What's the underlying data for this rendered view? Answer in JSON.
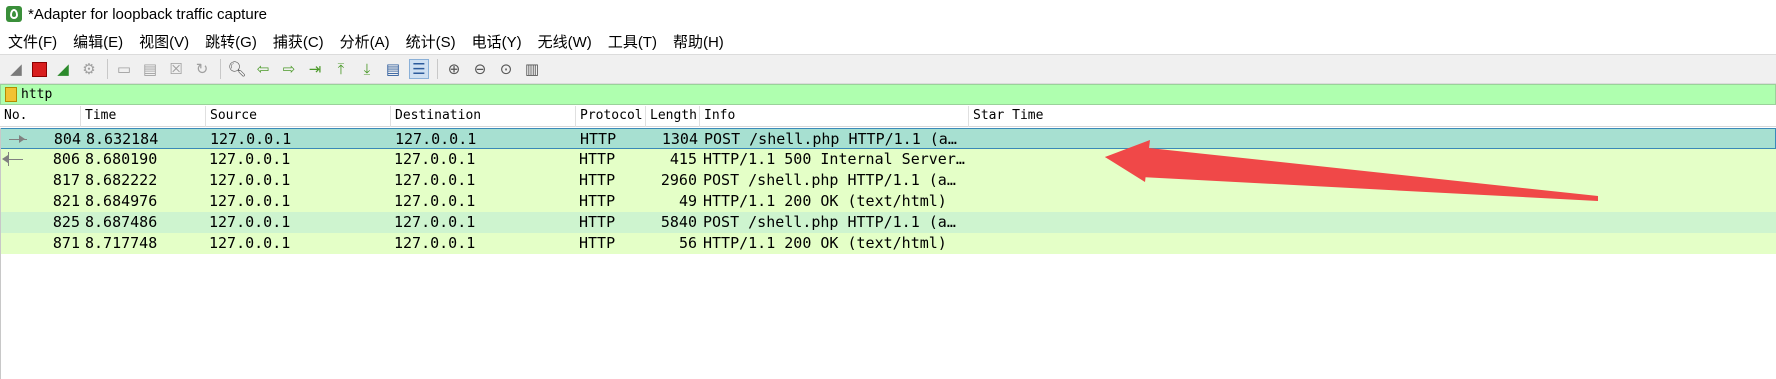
{
  "window": {
    "title": "*Adapter for loopback traffic capture"
  },
  "menu": [
    "文件(F)",
    "编辑(E)",
    "视图(V)",
    "跳转(G)",
    "捕获(C)",
    "分析(A)",
    "统计(S)",
    "电话(Y)",
    "无线(W)",
    "工具(T)",
    "帮助(H)"
  ],
  "toolbar": {
    "icons": [
      "shark-fin-icon",
      "stop-capture-icon",
      "restart-capture-icon",
      "capture-options-icon",
      "open-file-icon",
      "save-file-icon",
      "close-file-icon",
      "reload-icon",
      "find-packet-icon",
      "go-back-icon",
      "go-forward-icon",
      "go-to-packet-icon",
      "first-packet-icon",
      "last-packet-icon",
      "autoscroll-icon",
      "colorize-icon",
      "zoom-in-icon",
      "zoom-out-icon",
      "normal-size-icon",
      "resize-columns-icon"
    ]
  },
  "filter": {
    "value": "http"
  },
  "columns": [
    "No.",
    "Time",
    "Source",
    "Destination",
    "Protocol",
    "Length",
    "Info",
    "Star Time"
  ],
  "packets": [
    {
      "no": "804",
      "time": "8.632184",
      "source": "127.0.0.1",
      "destination": "127.0.0.1",
      "protocol": "HTTP",
      "length": "1304",
      "info": "POST /shell.php HTTP/1.1  (a…",
      "star_time": ""
    },
    {
      "no": "806",
      "time": "8.680190",
      "source": "127.0.0.1",
      "destination": "127.0.0.1",
      "protocol": "HTTP",
      "length": "415",
      "info": "HTTP/1.1 500 Internal Server…",
      "star_time": ""
    },
    {
      "no": "817",
      "time": "8.682222",
      "source": "127.0.0.1",
      "destination": "127.0.0.1",
      "protocol": "HTTP",
      "length": "2960",
      "info": "POST /shell.php HTTP/1.1  (a…",
      "star_time": ""
    },
    {
      "no": "821",
      "time": "8.684976",
      "source": "127.0.0.1",
      "destination": "127.0.0.1",
      "protocol": "HTTP",
      "length": "49",
      "info": "HTTP/1.1 200 OK  (text/html)",
      "star_time": ""
    },
    {
      "no": "825",
      "time": "8.687486",
      "source": "127.0.0.1",
      "destination": "127.0.0.1",
      "protocol": "HTTP",
      "length": "5840",
      "info": "POST /shell.php HTTP/1.1  (a…",
      "star_time": ""
    },
    {
      "no": "871",
      "time": "8.717748",
      "source": "127.0.0.1",
      "destination": "127.0.0.1",
      "protocol": "HTTP",
      "length": "56",
      "info": "HTTP/1.1 200 OK  (text/html)",
      "star_time": ""
    }
  ],
  "colors": {
    "filter_bg": "#afffaf",
    "row_http": "#e4ffc7",
    "row_alt": "#cef4cf",
    "row_selected": "#a7e0d1",
    "annotation_arrow": "#f04848"
  }
}
